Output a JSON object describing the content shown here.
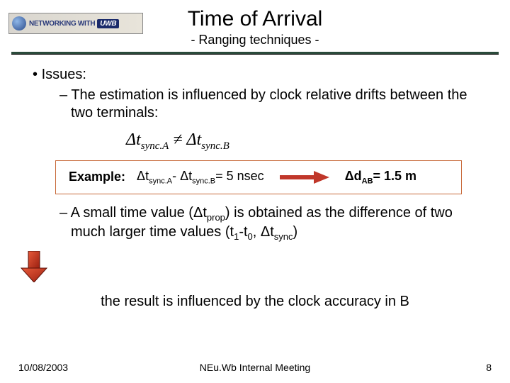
{
  "logo": {
    "text_a": "NETWORKING WITH",
    "text_b": "UWB"
  },
  "title": "Time of Arrival",
  "subtitle": "- Ranging techniques -",
  "bullets": {
    "issues": "Issues:",
    "b1": "The estimation is influenced by clock relative drifts between the two terminals:",
    "b2_pre": "A small time value (Δt",
    "b2_sub1": "prop",
    "b2_mid1": ") is obtained as the difference of two much larger time values (t",
    "b2_sub2": "1",
    "b2_mid2": "-t",
    "b2_sub3": "0",
    "b2_mid3": ", Δt",
    "b2_sub4": "sync",
    "b2_end": ")"
  },
  "formula": {
    "dt": "Δt",
    "subA": "sync.A",
    "neq": "≠",
    "subB": "sync.B"
  },
  "example": {
    "label": "Example:",
    "lhs_dt1": "Δt",
    "lhs_sub1": "sync.A",
    "lhs_minus": "- Δt",
    "lhs_sub2": "sync.B",
    "lhs_eq": "= 5 nsec",
    "rhs_d": "Δd",
    "rhs_sub": "AB",
    "rhs_eq": "= 1.5 m"
  },
  "conclusion": "the result is influenced by the clock accuracy in B",
  "footer": {
    "date": "10/08/2003",
    "center": "NEu.Wb Internal Meeting",
    "page": "8"
  }
}
